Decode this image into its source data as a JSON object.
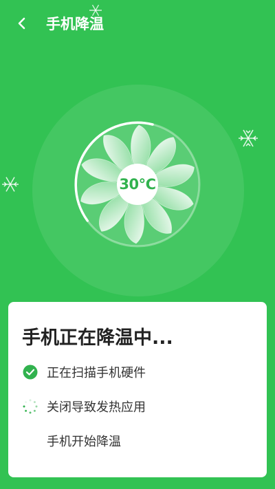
{
  "header": {
    "title": "手机降温",
    "back_icon": "chevron-left-icon"
  },
  "fan": {
    "temperature": "30℃",
    "progress_fraction": 0.35
  },
  "card": {
    "title": "手机正在降温中...",
    "steps": [
      {
        "label": "正在扫描手机硬件",
        "status": "done"
      },
      {
        "label": "关闭导致发热应用",
        "status": "in-progress"
      },
      {
        "label": "手机开始降温",
        "status": "pending"
      }
    ]
  },
  "colors": {
    "background": "#32c253",
    "accent": "#31b24e",
    "card": "#ffffff"
  }
}
